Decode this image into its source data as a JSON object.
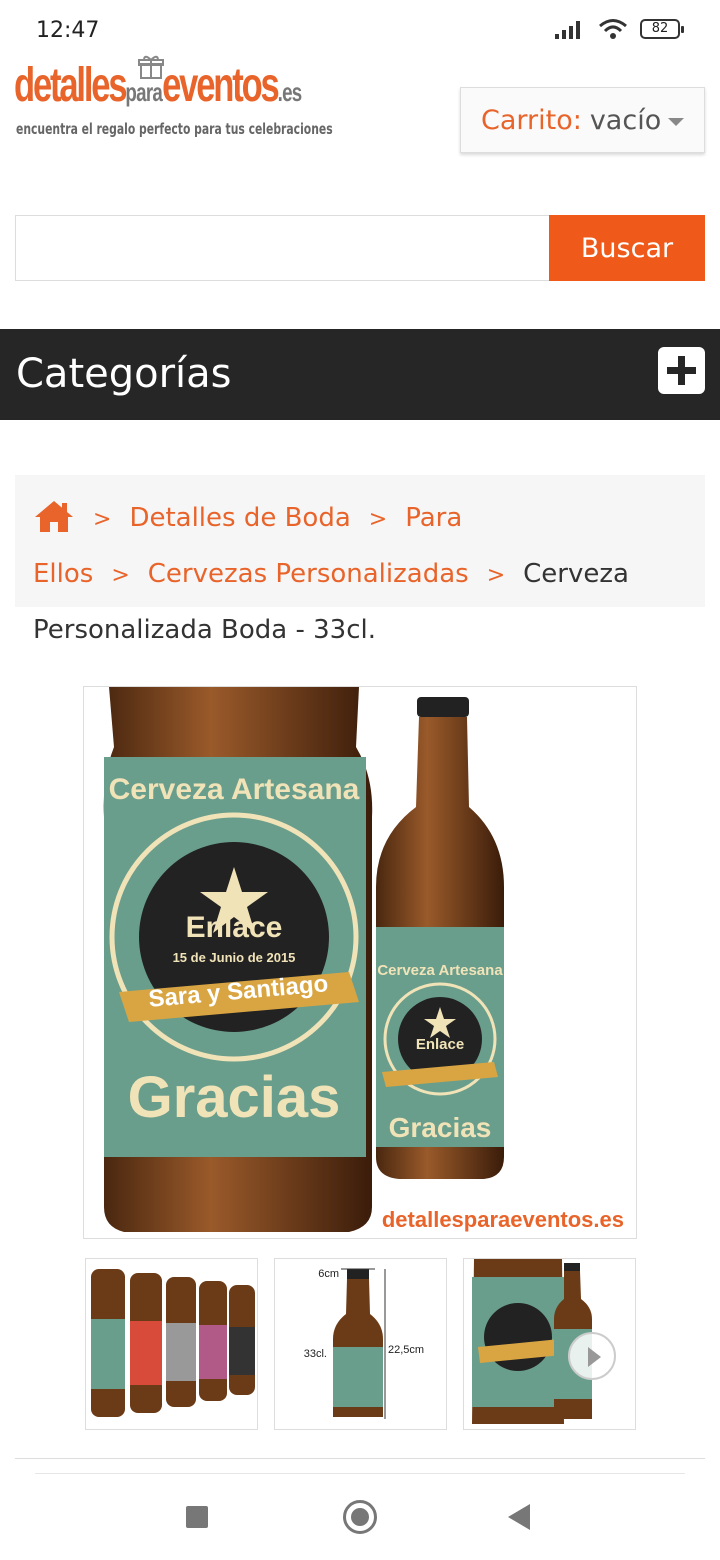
{
  "status_bar": {
    "time": "12:47",
    "battery": "82"
  },
  "logo": {
    "brand_part1": "detalles",
    "brand_part2": "para",
    "brand_part3": "eventos",
    "brand_tld": ".es",
    "tagline": "encuentra el regalo perfecto para tus celebraciones"
  },
  "cart": {
    "label": "Carrito:",
    "value": "vacío"
  },
  "search": {
    "placeholder": "",
    "button_label": "Buscar"
  },
  "categories": {
    "title": "Categorías"
  },
  "breadcrumb": {
    "items": [
      "Detalles de Boda",
      "Para Ellos",
      "Cervezas Personalizadas"
    ],
    "separator": ">",
    "current": "Cerveza Personalizada Boda - 33cl."
  },
  "product_image": {
    "label_top": "Cerveza Artesana",
    "badge_title": "Enlace",
    "badge_date": "15 de Junio de 2015",
    "badge_names": "Sara y Santiago",
    "label_bottom": "Gracias",
    "watermark": "detallesparaeventos.es"
  },
  "thumbnails": [
    {
      "kind": "group-bottles"
    },
    {
      "kind": "dimensions",
      "top_dim": "6cm",
      "left_dim": "33cl.",
      "right_dim": "22,5cm"
    },
    {
      "kind": "closeup"
    }
  ],
  "colors": {
    "accent": "#e8642a",
    "button": "#ef5a1a",
    "category_bar": "#262626",
    "label_green": "#6a9e8c"
  }
}
